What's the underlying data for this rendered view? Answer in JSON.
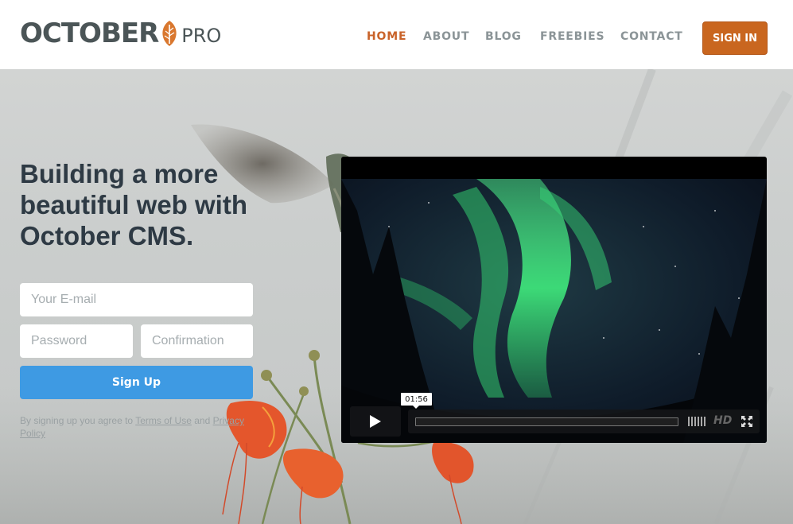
{
  "header": {
    "logo": {
      "text": "OCTOBER",
      "suffix": "PRO"
    },
    "nav": [
      {
        "label": "HOME",
        "active": true
      },
      {
        "label": "ABOUT",
        "active": false
      },
      {
        "label": "BLOG",
        "active": false
      },
      {
        "label": "FREEBIES",
        "active": false
      },
      {
        "label": "CONTACT",
        "active": false
      }
    ],
    "sign_in_label": "SIGN IN"
  },
  "hero": {
    "headline": [
      "Building a more",
      "beautiful web with",
      "October CMS."
    ],
    "form": {
      "email_placeholder": "Your E-mail",
      "password_placeholder": "Password",
      "confirmation_placeholder": "Confirmation",
      "submit_label": "Sign Up"
    },
    "terms": {
      "prefix": "By signing up you agree to ",
      "terms_link": "Terms of Use",
      "middle": " and ",
      "privacy_link": "Privacy Policy"
    }
  },
  "video": {
    "time": "01:56",
    "hd_label": "HD",
    "progress": 0.0,
    "icons": [
      "play-icon",
      "volume-icon",
      "fullscreen-icon"
    ]
  },
  "colors": {
    "accent": "#c9661f",
    "nav_active": "#c9632a",
    "nav": "#8b9497",
    "signup": "#3e9ae3",
    "headline": "#2e3a44"
  }
}
